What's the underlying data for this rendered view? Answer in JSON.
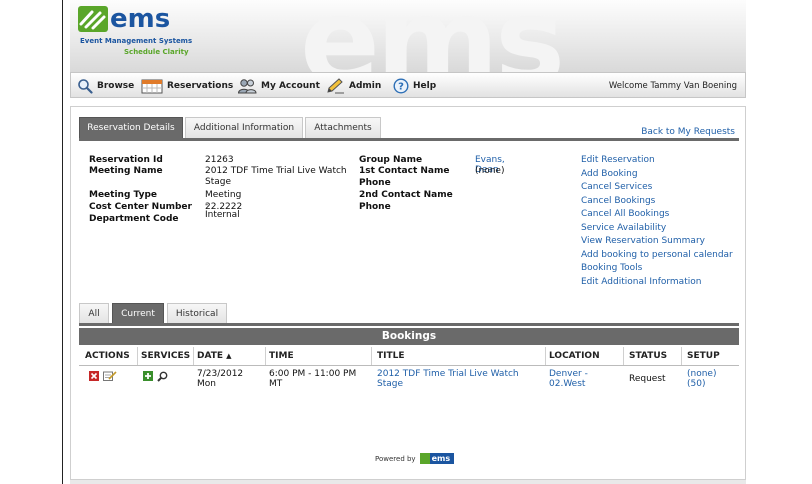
{
  "logo": {
    "text": "ems",
    "tagline": "Event Management Systems",
    "sub": "Schedule Clarity"
  },
  "nav": {
    "items": [
      {
        "label": "Browse",
        "icon": "magnifier-icon"
      },
      {
        "label": "Reservations",
        "icon": "calendar-icon"
      },
      {
        "label": "My Account",
        "icon": "users-icon"
      },
      {
        "label": "Admin",
        "icon": "pencil-icon"
      },
      {
        "label": "Help",
        "icon": "help-icon"
      }
    ],
    "welcome": "Welcome Tammy Van Boening"
  },
  "tabs": [
    "Reservation Details",
    "Additional Information",
    "Attachments"
  ],
  "back_link": "Back to My Requests",
  "reservation": {
    "id_label": "Reservation Id",
    "id": "21263",
    "meeting_name_label": "Meeting Name",
    "meeting_name": "2012 TDF Time Trial Live Watch Stage",
    "meeting_type_label": "Meeting Type",
    "meeting_type": "Meeting - Internal",
    "cost_center_label": "Cost Center Number",
    "cost_center": "22.2222",
    "dept_label": "Department Code",
    "group_label": "Group Name",
    "group": "Evans, Dean",
    "contact1_label": "1st Contact Name",
    "contact1": "(none)",
    "phone1_label": "Phone",
    "contact2_label": "2nd Contact Name",
    "phone2_label": "Phone"
  },
  "actions": [
    "Edit Reservation",
    "Add Booking",
    "Cancel Services",
    "Cancel Bookings",
    "Cancel All Bookings",
    "Service Availability",
    "View Reservation Summary",
    "Add booking to personal calendar",
    "Booking Tools",
    "Edit Additional Information"
  ],
  "booking_tabs": [
    "All",
    "Current",
    "Historical"
  ],
  "bookings": {
    "title": "Bookings",
    "columns": [
      "ACTIONS",
      "SERVICES",
      "DATE",
      "TIME",
      "TITLE",
      "LOCATION",
      "STATUS",
      "SETUP"
    ],
    "sort_glyph": "▲",
    "rows": [
      {
        "date_line1": "7/23/2012",
        "date_line2": "Mon",
        "time_line1": "6:00 PM - 11:00 PM",
        "time_line2": "MT",
        "title": "2012 TDF Time Trial Live Watch Stage",
        "location_line1": "Denver -",
        "location_line2": "02.West",
        "status": "Request",
        "setup_line1": "(none)",
        "setup_line2": "(50)"
      }
    ]
  },
  "footer": {
    "powered_by": "Powered by",
    "logo": "ems"
  },
  "colors": {
    "link": "#1f5fa8",
    "tab_dark": "#6a6a6a",
    "brand_blue": "#1b55a0",
    "brand_green": "#5aa62a"
  }
}
